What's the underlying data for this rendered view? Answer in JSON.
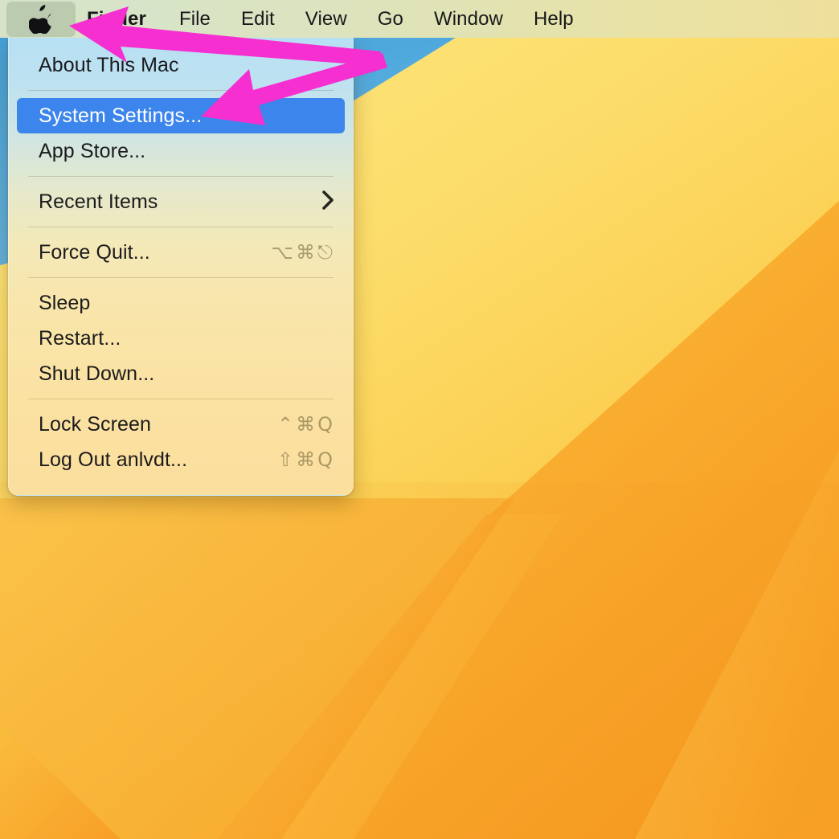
{
  "menubar": {
    "apple_icon": "apple-logo-icon",
    "items": [
      {
        "label": "Finder",
        "bold": true
      },
      {
        "label": "File",
        "bold": false
      },
      {
        "label": "Edit",
        "bold": false
      },
      {
        "label": "View",
        "bold": false
      },
      {
        "label": "Go",
        "bold": false
      },
      {
        "label": "Window",
        "bold": false
      },
      {
        "label": "Help",
        "bold": false
      }
    ]
  },
  "apple_menu": {
    "items": [
      {
        "label": "About This Mac",
        "shortcut": "",
        "selected": false,
        "submenu": false
      },
      {
        "label": "System Settings...",
        "shortcut": "",
        "selected": true,
        "submenu": false
      },
      {
        "label": "App Store...",
        "shortcut": "",
        "selected": false,
        "submenu": false
      },
      {
        "label": "Recent Items",
        "shortcut": "",
        "selected": false,
        "submenu": true
      },
      {
        "label": "Force Quit...",
        "shortcut": "⌥⌘⎋",
        "selected": false,
        "submenu": false
      },
      {
        "label": "Sleep",
        "shortcut": "",
        "selected": false,
        "submenu": false
      },
      {
        "label": "Restart...",
        "shortcut": "",
        "selected": false,
        "submenu": false
      },
      {
        "label": "Shut Down...",
        "shortcut": "",
        "selected": false,
        "submenu": false
      },
      {
        "label": "Lock Screen",
        "shortcut": "⌃⌘Q",
        "selected": false,
        "submenu": false
      },
      {
        "label": "Log Out anlvdt...",
        "shortcut": "⇧⌘Q",
        "selected": false,
        "submenu": false
      }
    ],
    "submenu_glyph": "›",
    "highlight_color": "#3c85ec"
  },
  "annotations": {
    "arrow_color": "#F62FD0",
    "arrows": [
      {
        "name": "arrow-to-apple-menu",
        "points_to": "apple-logo-icon"
      },
      {
        "name": "arrow-to-system-settings",
        "points_to": "System Settings..."
      }
    ]
  },
  "desktop": {
    "wallpaper_name": "macos-ventura-wallpaper",
    "colors": {
      "sky_blue": "#54AADE",
      "pale_yellow": "#FBE27A",
      "yellow": "#FBC944",
      "orange": "#F79A27",
      "deep_orange": "#F6901E"
    }
  }
}
